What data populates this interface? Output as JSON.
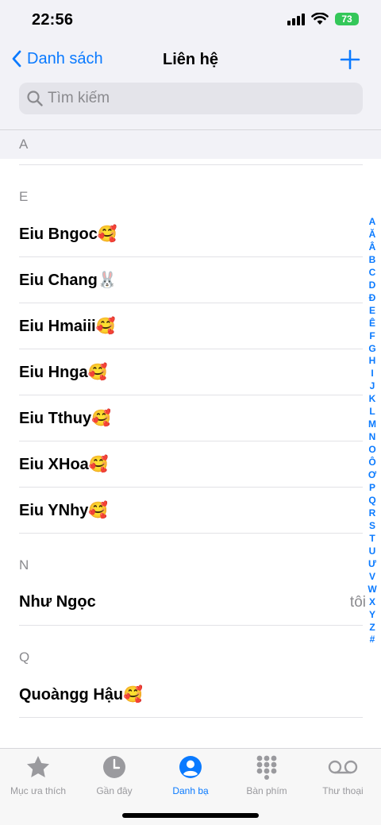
{
  "status": {
    "time": "22:56",
    "battery": "73"
  },
  "nav": {
    "back_label": "Danh sách",
    "title": "Liên hệ"
  },
  "search": {
    "placeholder": "Tìm kiếm"
  },
  "sections": {
    "a": {
      "letter": "A"
    },
    "e": {
      "letter": "E",
      "contacts": [
        "Eiu Bngoc🥰",
        "Eiu Chang🐰",
        "Eiu Hmaiii🥰",
        "Eiu Hnga🥰",
        "Eiu Tthuy🥰",
        "Eiu XHoa🥰",
        "Eiu YNhy🥰"
      ]
    },
    "n": {
      "letter": "N",
      "contacts": [
        "Như Ngọc"
      ],
      "me_badge": "tôi"
    },
    "q": {
      "letter": "Q",
      "contacts": [
        "Quoàngg Hậu🥰"
      ]
    }
  },
  "index_letters": [
    "A",
    "Ă",
    "Â",
    "B",
    "C",
    "D",
    "Đ",
    "E",
    "Ê",
    "F",
    "G",
    "H",
    "I",
    "J",
    "K",
    "L",
    "M",
    "N",
    "O",
    "Ô",
    "Ơ",
    "P",
    "Q",
    "R",
    "S",
    "T",
    "U",
    "Ư",
    "V",
    "W",
    "X",
    "Y",
    "Z",
    "#"
  ],
  "tabs": [
    "Mục ưa thích",
    "Gần đây",
    "Danh bạ",
    "Bàn phím",
    "Thư thoại"
  ],
  "colors": {
    "accent": "#0a7aff",
    "battery": "#34c759",
    "inactive": "#9a9a9e"
  }
}
